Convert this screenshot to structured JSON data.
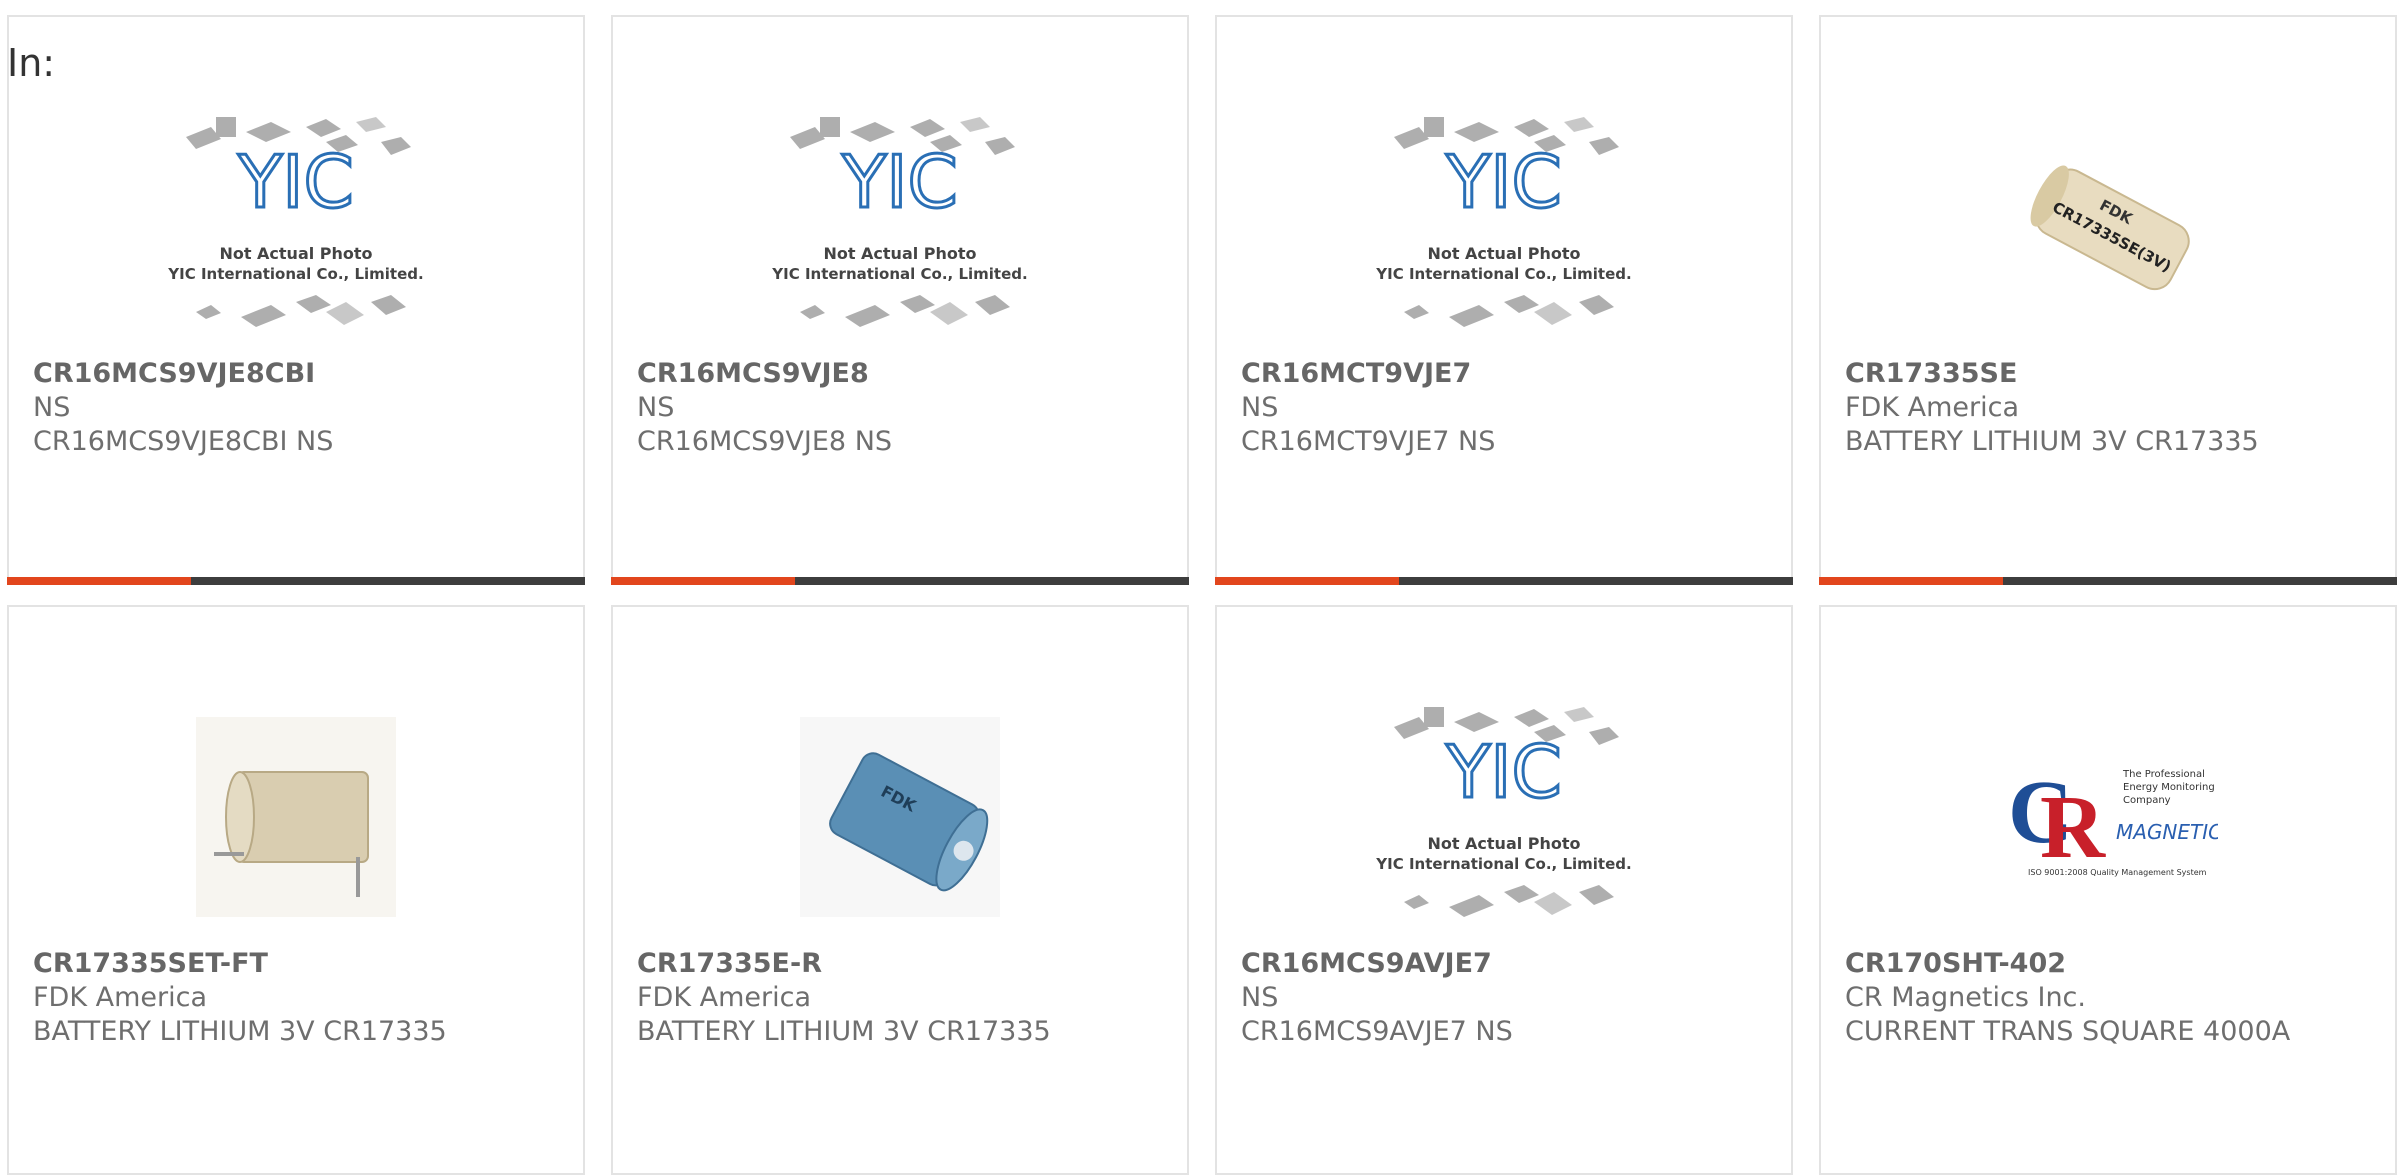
{
  "header": {
    "prefix_label": "In:"
  },
  "placeholder_image": {
    "line1": "Not Actual Photo",
    "line2": "YIC International Co., Limited.",
    "logo_text": "YIC"
  },
  "fdk_image": {
    "brand": "FDK",
    "label": "CR17335SE(3V)"
  },
  "crmag_image": {
    "tagline1": "The Professional",
    "tagline2": "Energy Monitoring",
    "tagline3": "Company",
    "wordmark": "MAGNETICS",
    "iso": "ISO 9001:2008 Quality Management System"
  },
  "products": [
    {
      "part": "CR16MCS9VJE8CBI",
      "manufacturer": "NS",
      "description": "CR16MCS9VJE8CBI NS",
      "image": "placeholder-photo-icon"
    },
    {
      "part": "CR16MCS9VJE8",
      "manufacturer": "NS",
      "description": "CR16MCS9VJE8 NS",
      "image": "placeholder-photo-icon"
    },
    {
      "part": "CR16MCT9VJE7",
      "manufacturer": "NS",
      "description": "CR16MCT9VJE7 NS",
      "image": "placeholder-photo-icon"
    },
    {
      "part": "CR17335SE",
      "manufacturer": "FDK America",
      "description": "BATTERY LITHIUM 3V CR17335",
      "image": "battery-photo"
    },
    {
      "part": "CR17335SET-FT",
      "manufacturer": "FDK America",
      "description": "BATTERY LITHIUM 3V CR17335",
      "image": "battery-tabbed-photo"
    },
    {
      "part": "CR17335E-R",
      "manufacturer": "FDK America",
      "description": "BATTERY LITHIUM 3V CR17335",
      "image": "battery-blue-photo"
    },
    {
      "part": "CR16MCS9AVJE7",
      "manufacturer": "NS",
      "description": "CR16MCS9AVJE7 NS",
      "image": "placeholder-photo-icon"
    },
    {
      "part": "CR170SHT-402",
      "manufacturer": "CR Magnetics Inc.",
      "description": "CURRENT TRANS SQUARE 4000A",
      "image": "cr-magnetics-logo"
    }
  ],
  "colors": {
    "accent": "#e2461d",
    "bar": "#3d3d3d",
    "border": "#e3e3e3"
  }
}
